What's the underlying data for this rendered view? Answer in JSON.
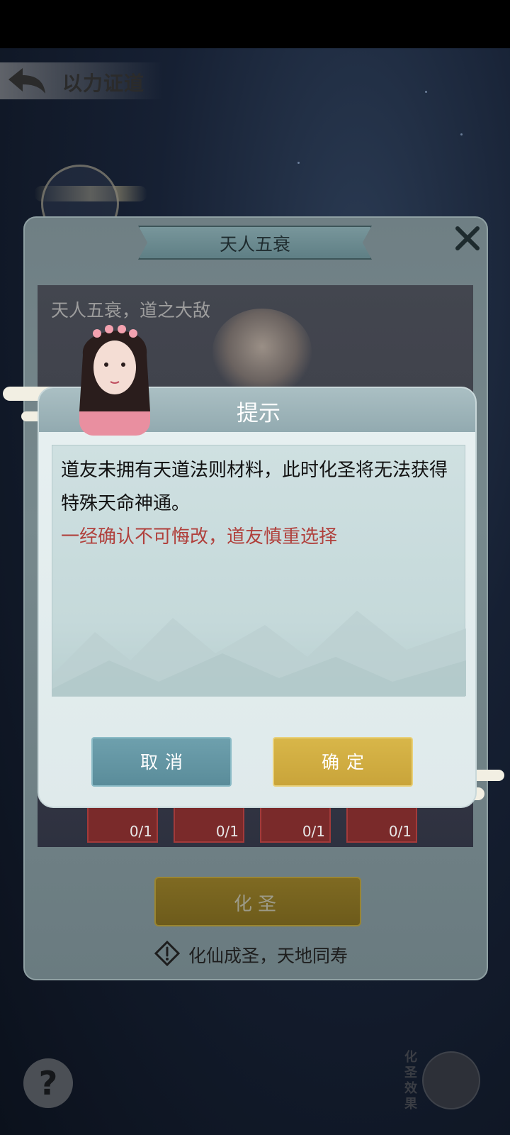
{
  "header": {
    "title": "以力证道"
  },
  "panel": {
    "title": "天人五衰",
    "subtitle": "天人五衰，道之大敌",
    "slots": [
      {
        "count": "0/1"
      },
      {
        "count": "0/1"
      },
      {
        "count": "0/1"
      },
      {
        "count": "0/1"
      }
    ],
    "action_label": "化圣",
    "hint": "化仙成圣，天地同寿"
  },
  "side": {
    "help_symbol": "?",
    "effect_label": "化圣效果"
  },
  "dialog": {
    "title": "提示",
    "message": "道友未拥有天道法则材料，此时化圣将无法获得特殊天命神通。",
    "warning": "一经确认不可悔改，道友慎重选择",
    "cancel_label": "取消",
    "confirm_label": "确定"
  },
  "colors": {
    "warning_text": "#b0403c",
    "cancel_button": "#5a8c9a",
    "confirm_button": "#c9a43a",
    "dialog_header": "#92aab0"
  }
}
